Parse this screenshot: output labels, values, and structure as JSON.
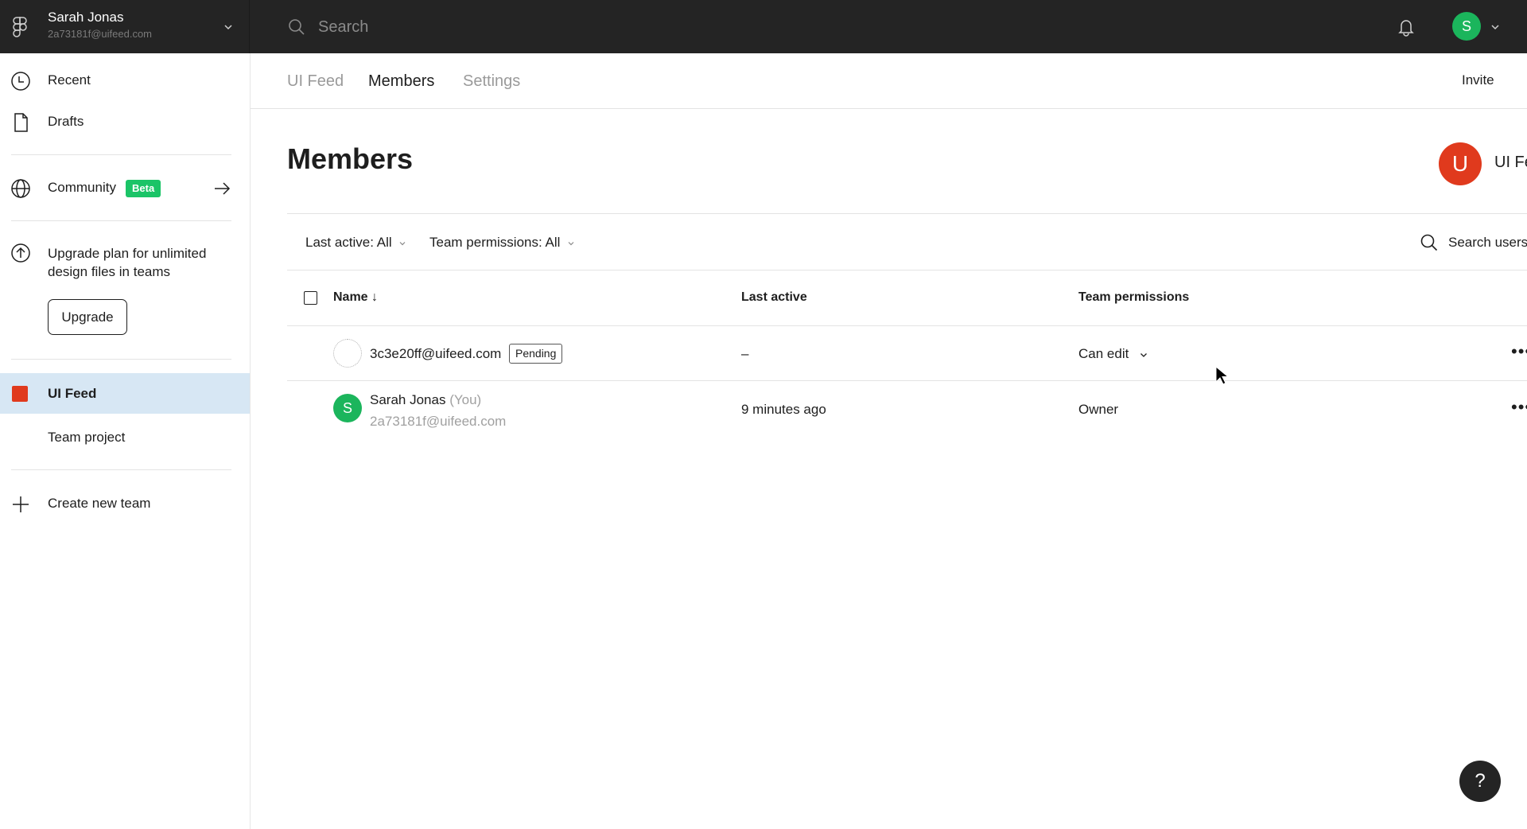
{
  "topbar": {
    "user_name": "Sarah Jonas",
    "user_email": "2a73181f@uifeed.com",
    "search_placeholder": "Search",
    "avatar_initial": "S",
    "avatar_color": "#1bb55c"
  },
  "sidebar": {
    "items": [
      {
        "label": "Recent",
        "icon": "clock-icon"
      },
      {
        "label": "Drafts",
        "icon": "file-icon"
      }
    ],
    "community": {
      "label": "Community",
      "badge": "Beta",
      "icon": "globe-icon"
    },
    "upgrade": {
      "text": "Upgrade plan for unlimited design files in teams",
      "button": "Upgrade"
    },
    "teams": [
      {
        "label": "UI Feed",
        "active": true,
        "color": "#e03a1d"
      },
      {
        "label": "Team project",
        "active": false
      }
    ],
    "create_team": "Create new team"
  },
  "main": {
    "tabs": [
      {
        "label": "UI Feed",
        "active": false
      },
      {
        "label": "Members",
        "active": true
      },
      {
        "label": "Settings",
        "active": false
      }
    ],
    "invite_label": "Invite",
    "page_title": "Members",
    "team": {
      "initial": "U",
      "name": "UI Feed",
      "color": "#e03a1d"
    },
    "filters": {
      "last_active": "Last active: All",
      "team_permissions": "Team permissions: All"
    },
    "search_users_placeholder": "Search users",
    "table": {
      "columns": [
        "Name",
        "Last active",
        "Team permissions"
      ],
      "sort_indicator": "↓",
      "rows": [
        {
          "email": "3c3e20ff@uifeed.com",
          "badge": "Pending",
          "last_active": "–",
          "permission": "Can edit",
          "has_dropdown": true
        },
        {
          "name": "Sarah Jonas",
          "you_tag": "(You)",
          "email": "2a73181f@uifeed.com",
          "avatar_initial": "S",
          "last_active": "9 minutes ago",
          "permission": "Owner",
          "has_dropdown": false
        }
      ],
      "more_label": "•••"
    },
    "help_label": "?"
  }
}
